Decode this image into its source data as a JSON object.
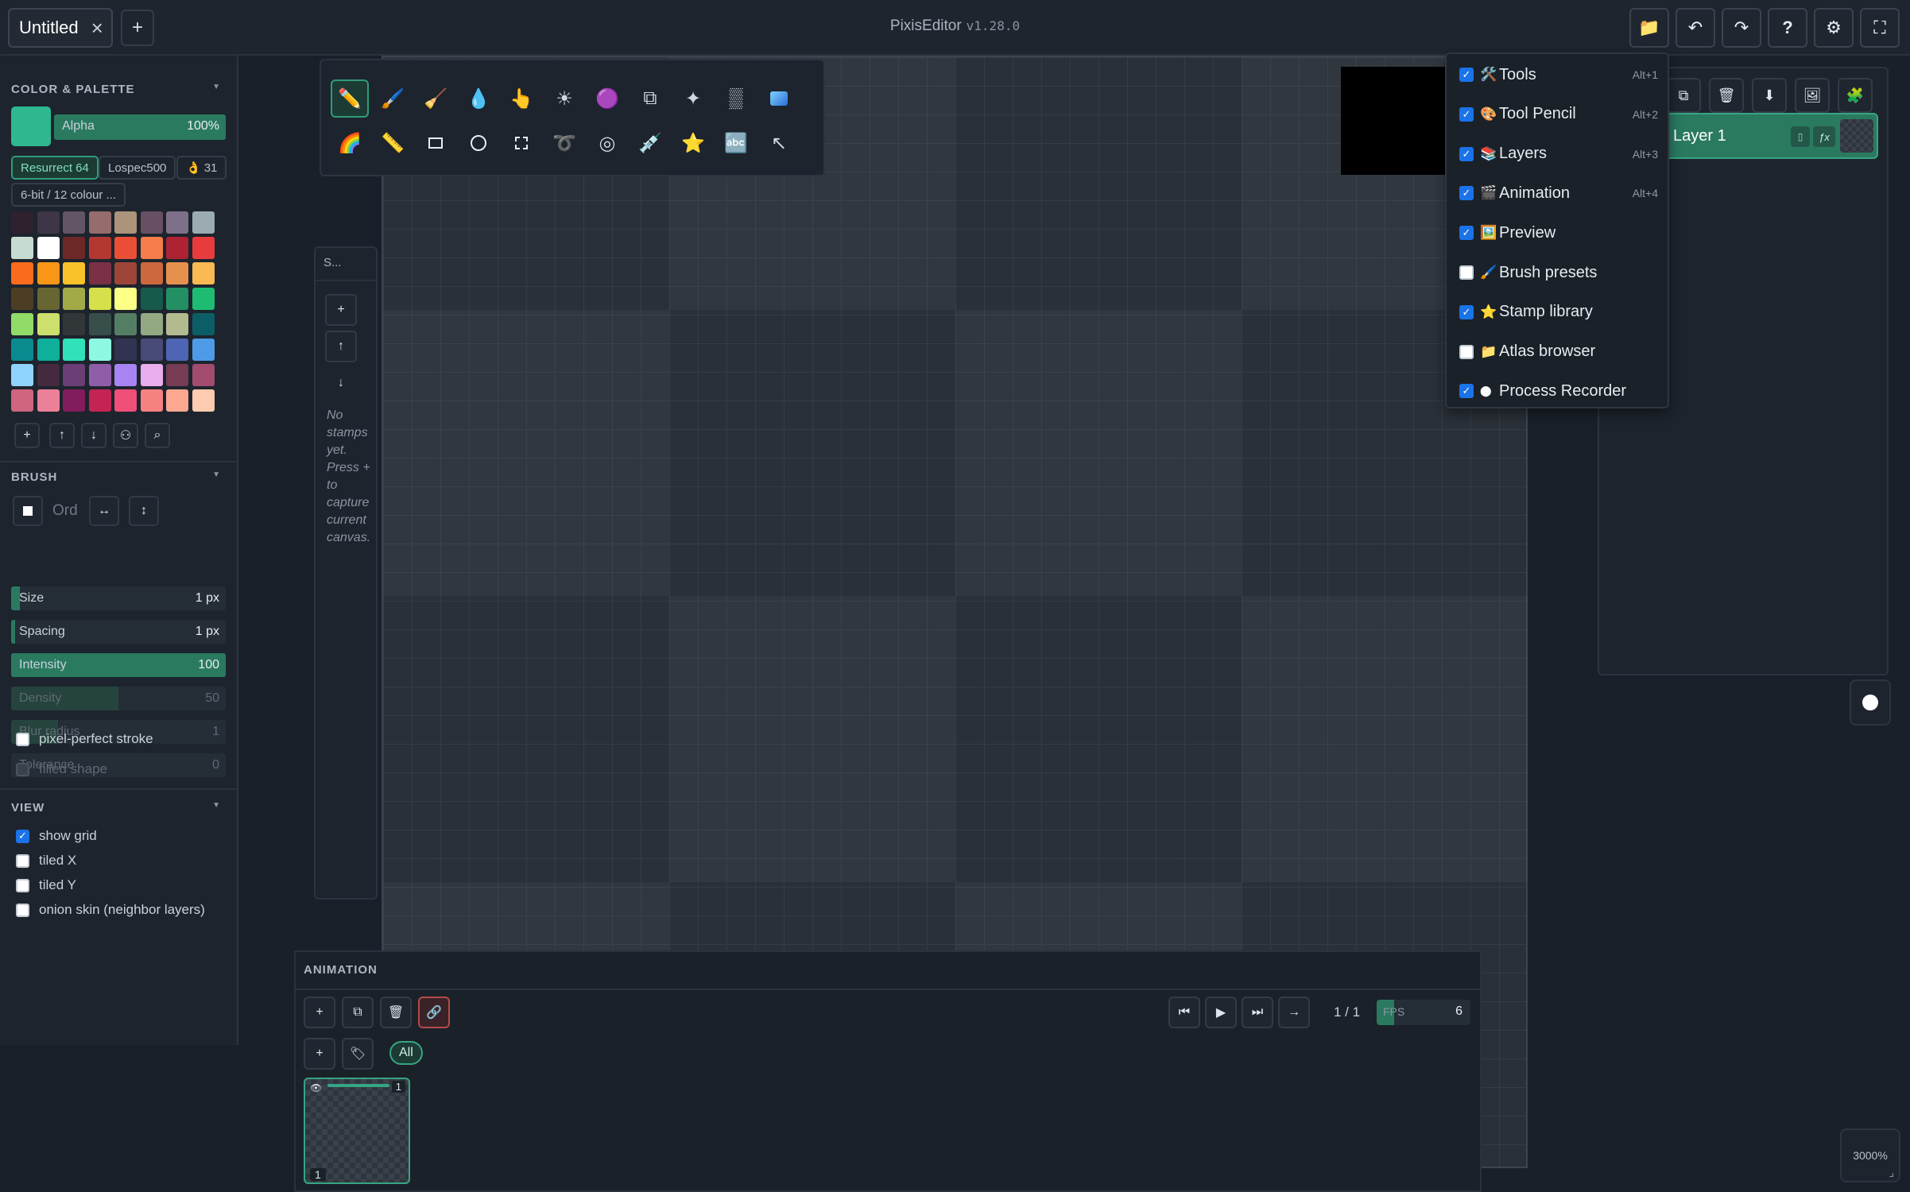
{
  "tab": {
    "title": "Untitled",
    "add": "+"
  },
  "app": {
    "name": "PixisEditor",
    "version": "v1.28.0"
  },
  "color_palette": {
    "section_title": "COLOR & PALETTE",
    "current_color": "#2fb890",
    "alpha_label": "Alpha",
    "alpha_value": "100%",
    "palettes": [
      "Resurrect 64",
      "Lospec500"
    ],
    "likes": "31",
    "palette_desc": "6-bit / 12 colour ...",
    "swatches": [
      "#2e222f",
      "#3e3546",
      "#625565",
      "#966c6c",
      "#ab947a",
      "#694f62",
      "#7f708a",
      "#9babb2",
      "#c7dcd0",
      "#ffffff",
      "#6e2727",
      "#b33831",
      "#ea4f36",
      "#f57d4a",
      "#ae2334",
      "#e83b3b",
      "#fb6b1d",
      "#f79617",
      "#f9c22b",
      "#7a3045",
      "#9e4539",
      "#cd683d",
      "#e6904e",
      "#fbb954",
      "#4c3e24",
      "#676633",
      "#a2a947",
      "#d5e04b",
      "#fbff86",
      "#165a4c",
      "#239063",
      "#1ebc73",
      "#91db69",
      "#cddf6c",
      "#313638",
      "#374e4a",
      "#547e64",
      "#92a984",
      "#b2ba90",
      "#0b5e65",
      "#0b8a8f",
      "#0eaf9b",
      "#30e1b9",
      "#8ff8e2",
      "#323353",
      "#484a77",
      "#4d65b4",
      "#4d9be6",
      "#8fd3ff",
      "#45293f",
      "#6b3e75",
      "#905ea9",
      "#a884f3",
      "#eaaded",
      "#753c54",
      "#a24b6f",
      "#cf657f",
      "#ed8099",
      "#831c5d",
      "#c32454",
      "#f04f78",
      "#f68181",
      "#fca790",
      "#fdcbb0"
    ]
  },
  "brush": {
    "section_title": "BRUSH",
    "mode": "Ord",
    "sliders": [
      {
        "label": "Size",
        "value": "1 px",
        "fill": 0.04,
        "dim": false
      },
      {
        "label": "Spacing",
        "value": "1 px",
        "fill": 0.02,
        "dim": false
      },
      {
        "label": "Intensity",
        "value": "100",
        "fill": 1.0,
        "dim": false
      },
      {
        "label": "Density",
        "value": "50",
        "fill": 0.5,
        "dim": true
      },
      {
        "label": "Blur radius",
        "value": "1",
        "fill": 0.22,
        "dim": true
      },
      {
        "label": "Tolerance",
        "value": "0",
        "fill": 0.0,
        "dim": true
      }
    ],
    "pixel_perfect": "pixel-perfect stroke",
    "filled_shape": "filled shape"
  },
  "view": {
    "section_title": "VIEW",
    "show_grid": "show grid",
    "tiled_x": "tiled X",
    "tiled_y": "tiled Y",
    "onion_skin": "onion skin (neighbor layers)"
  },
  "stamp": {
    "title": "S...",
    "empty_message": "No stamps yet. Press  +  to capture current canvas."
  },
  "layers": {
    "layer_name": "Layer 1",
    "fx": "ƒx"
  },
  "menu": [
    {
      "icon": "🛠️",
      "label": "Tools",
      "shortcut": "Alt+1",
      "checked": true
    },
    {
      "icon": "🎨",
      "label": "Tool Pencil",
      "shortcut": "Alt+2",
      "checked": true
    },
    {
      "icon": "📚",
      "label": "Layers",
      "shortcut": "Alt+3",
      "checked": true
    },
    {
      "icon": "🎬",
      "label": "Animation",
      "shortcut": "Alt+4",
      "checked": true
    },
    {
      "icon": "🖼️",
      "label": "Preview",
      "shortcut": "",
      "checked": true
    },
    {
      "icon": "🖌️",
      "label": "Brush presets",
      "shortcut": "",
      "checked": false
    },
    {
      "icon": "⭐",
      "label": "Stamp library",
      "shortcut": "",
      "checked": true
    },
    {
      "icon": "📁",
      "label": "Atlas browser",
      "shortcut": "",
      "checked": false
    },
    {
      "icon": "⬤",
      "label": "Process Recorder",
      "shortcut": "",
      "checked": true
    }
  ],
  "animation": {
    "title": "ANIMATION",
    "frame_counter": "1 / 1",
    "fps_label": "FPS",
    "fps_value": "6",
    "filter_all": "All",
    "frame_number": "1",
    "frame_layer_count": "1"
  },
  "zoom": "3000%"
}
